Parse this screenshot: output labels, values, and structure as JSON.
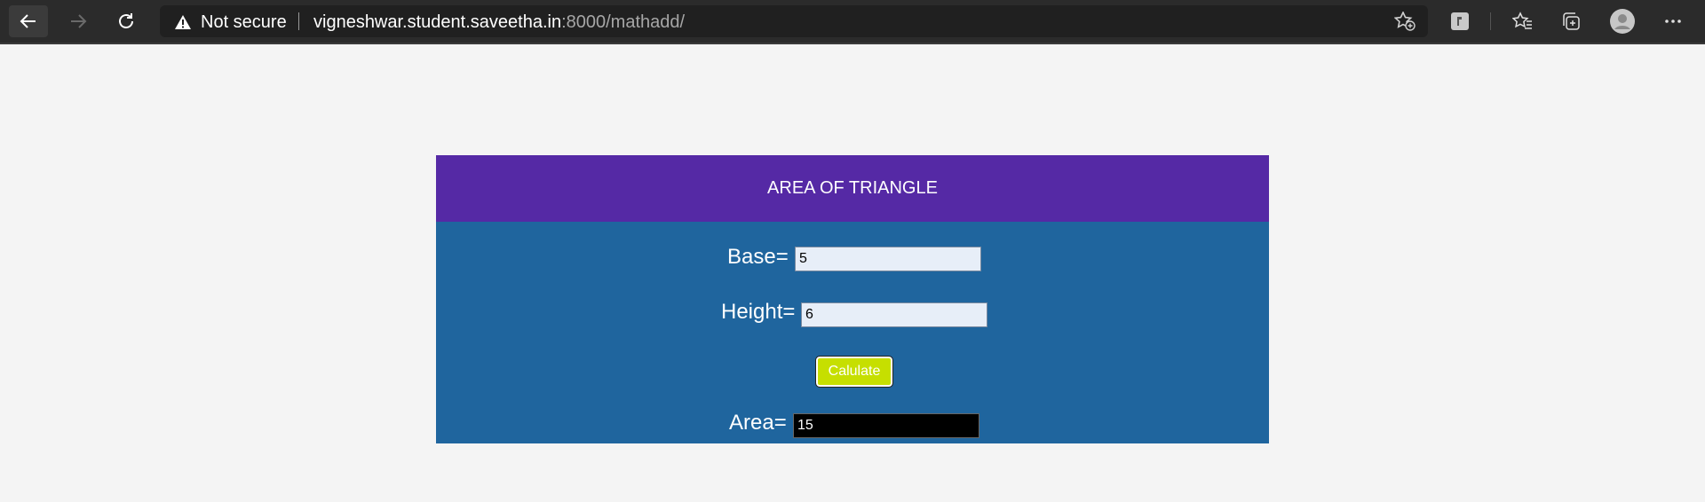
{
  "browser": {
    "security_label": "Not secure",
    "url_host": "vigneshwar.student.saveetha.in",
    "url_rest": ":8000/mathadd/"
  },
  "page": {
    "header_title": "AREA OF TRIANGLE",
    "base_label": "Base=",
    "base_value": "5",
    "height_label": "Height=",
    "height_value": "6",
    "calculate_label": "Calulate",
    "area_label": "Area=",
    "area_value": "15"
  },
  "colors": {
    "header_bg": "#5529a5",
    "card_bg": "#1f659e",
    "button_bg": "#c6df00",
    "area_field_bg": "#000000"
  }
}
